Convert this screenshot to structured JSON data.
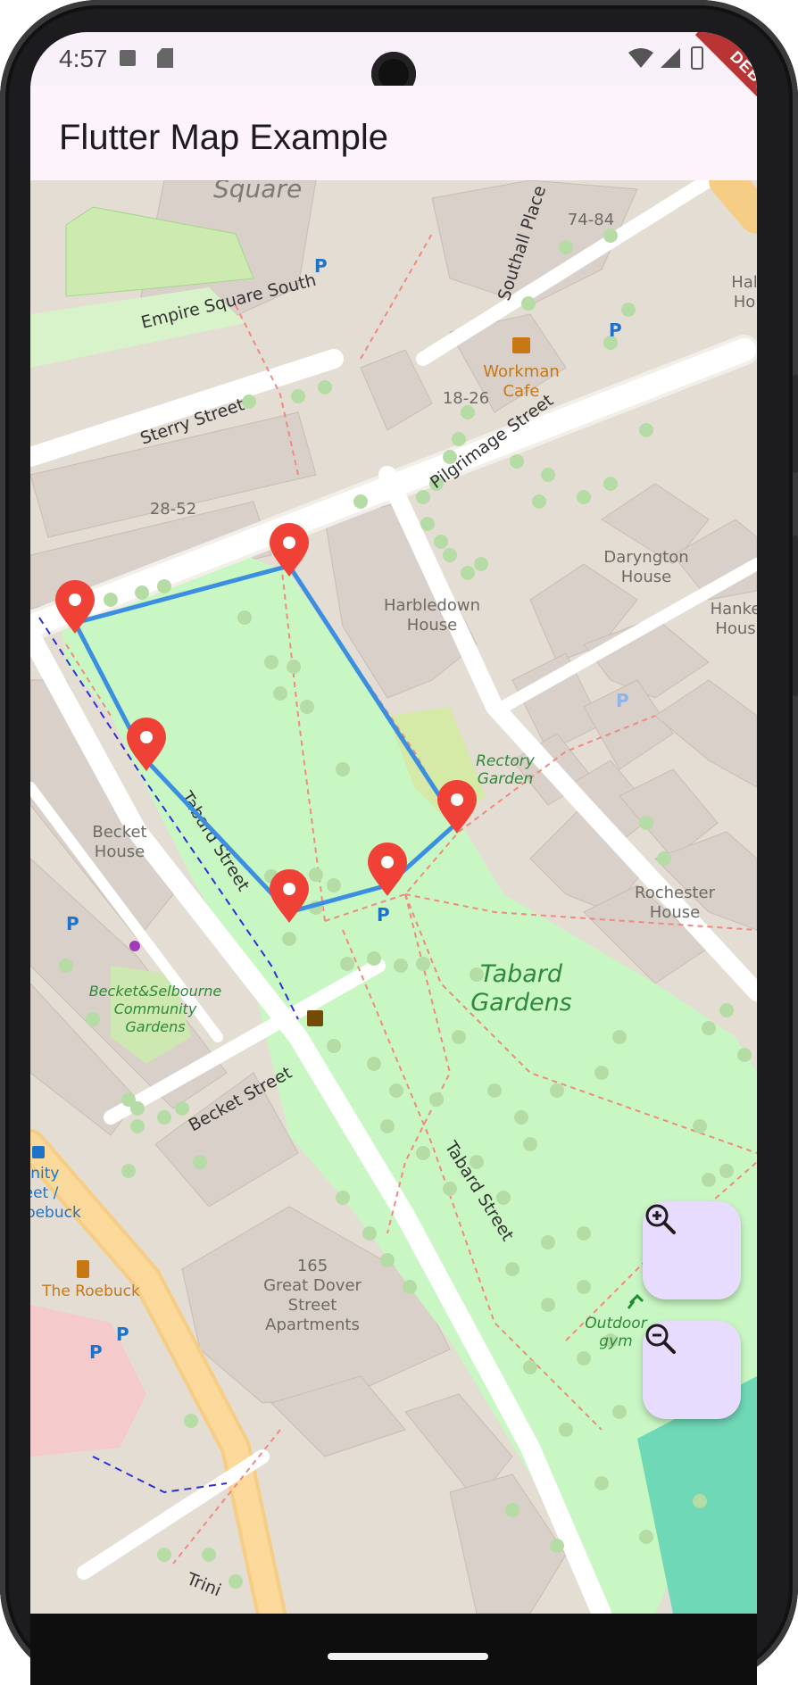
{
  "status_bar": {
    "time": "4:57",
    "icons": [
      "a-icon",
      "sd-card-icon",
      "wifi-icon",
      "signal-icon",
      "battery-icon"
    ]
  },
  "app_bar": {
    "title": "Flutter Map Example"
  },
  "debug_banner": "DEBUG",
  "map": {
    "street_labels": {
      "square": "Square",
      "empire_square_south": "Empire Square South",
      "southall_place": "Southall Place",
      "sterry_street": "Sterry Street",
      "pilgrimage_street": "Pilgrimage Street",
      "tabard_street_1": "Tabard Street",
      "tabard_street_2": "Tabard Street",
      "becket_street": "Becket Street",
      "trinity_partial": "Trini"
    },
    "building_labels": {
      "b_74_84": "74-84",
      "b_18_26": "18-26",
      "b_28_52": "28-52",
      "harbledown_1": "Harbledown",
      "harbledown_2": "House",
      "darygton_1": "Daryngton",
      "darygton_2": "House",
      "hanke_1": "Hanke",
      "hanke_2": "Hous",
      "hal_1": "Hal",
      "hal_2": "Ho",
      "becket_1": "Becket",
      "becket_2": "House",
      "rochester_1": "Rochester",
      "rochester_2": "House",
      "gds_1": "165",
      "gds_2": "Great Dover",
      "gds_3": "Street",
      "gds_4": "Apartments"
    },
    "poi_labels": {
      "workman_1": "Workman",
      "workman_2": "Cafe",
      "rectory_1": "Rectory",
      "rectory_2": "Garden",
      "tabard_gardens_1": "Tabard",
      "tabard_gardens_2": "Gardens",
      "bsc_1": "Becket&Selbourne",
      "bsc_2": "Community",
      "bsc_3": "Gardens",
      "roebuck": "The Roebuck",
      "outdoor_1": "Outdoor",
      "outdoor_2": "gym",
      "bus_1": "inity",
      "bus_2": "eet /",
      "bus_3": "oebuck",
      "parking": "P"
    },
    "polygon_color": "#3c8fe0",
    "marker_color": "#ef4136",
    "marker_count": 6
  },
  "controls": {
    "zoom_in": "zoom-in-icon",
    "zoom_out": "zoom-out-icon"
  }
}
